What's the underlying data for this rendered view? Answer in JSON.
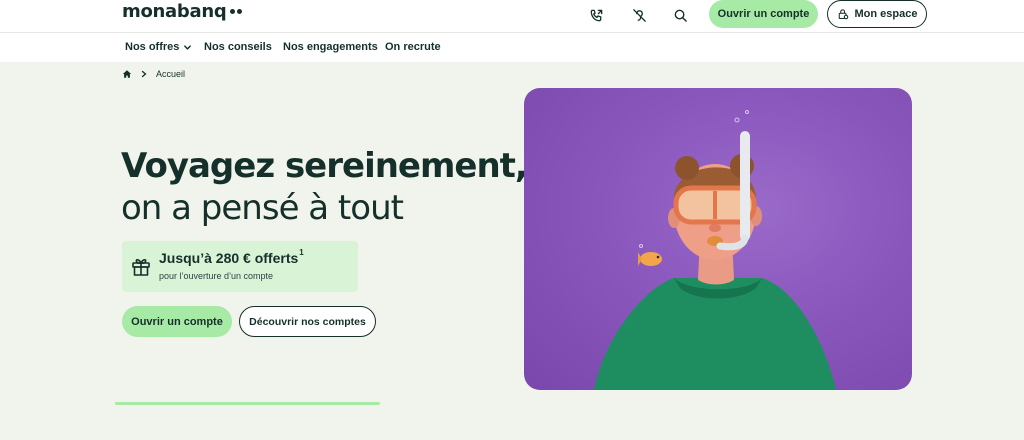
{
  "header": {
    "logo": "monabanq",
    "icons": [
      "phone-icon",
      "accessibility-icon",
      "search-icon"
    ],
    "open_account_label": "Ouvrir un compte",
    "my_space_label": "Mon espace"
  },
  "nav": {
    "items": [
      {
        "label": "Nos offres"
      },
      {
        "label": "Nos conseils"
      },
      {
        "label": "Nos engagements"
      },
      {
        "label": "On recrute"
      }
    ]
  },
  "breadcrumb": {
    "home_icon": "home-icon",
    "current": "Accueil"
  },
  "hero": {
    "title_line1": "Voyagez sereinement,",
    "title_line2": "on a pensé à tout",
    "offer": {
      "main": "Jusqu’à 280 € offerts",
      "sup": "1",
      "sub": "pour l’ouverture d’un compte",
      "icon": "gift-icon"
    },
    "cta_primary": "Ouvrir un compte",
    "cta_secondary": "Découvrir nos comptes"
  },
  "colors": {
    "brand_dark": "#15302a",
    "accent_green": "#a6eaa6",
    "background": "#f1f4ec",
    "offer_bg": "#d9f3d7",
    "hero_purple": "#8a57bd"
  }
}
